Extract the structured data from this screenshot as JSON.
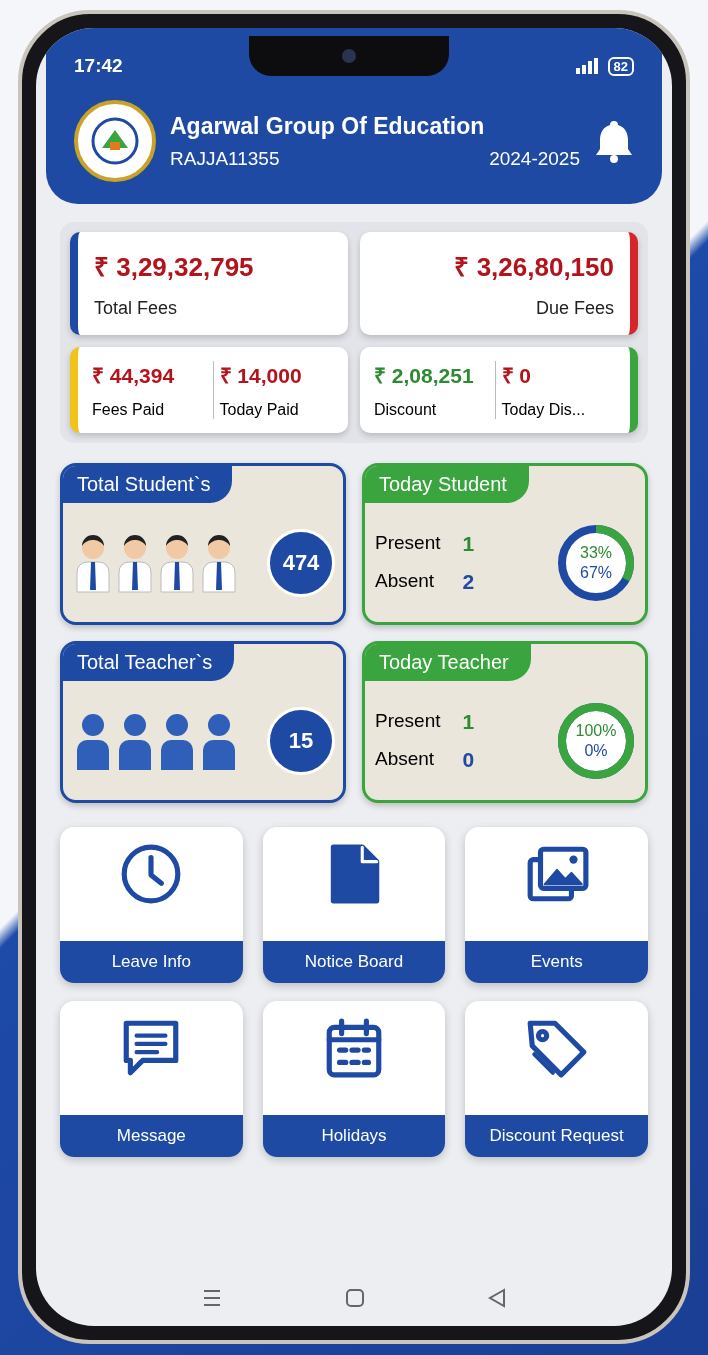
{
  "status_bar": {
    "time": "17:42",
    "battery": "82"
  },
  "header": {
    "school": "Agarwal Group Of Education",
    "code": "RAJJA11355",
    "session": "2024-2025"
  },
  "fee_cards": [
    {
      "amount": "₹ 3,29,32,795",
      "label": "Total Fees",
      "color": "#1f4aa3"
    },
    {
      "amount": "₹ 3,26,80,150",
      "label": "Due Fees",
      "color": "#d7262b"
    }
  ],
  "fee_pairs": [
    {
      "color": "#f0c419",
      "items": [
        {
          "amount": "₹ 44,394",
          "label": "Fees Paid",
          "color": "#b3141c"
        },
        {
          "amount": "₹ 14,000",
          "label": "Today Paid",
          "color": "#b3141c"
        }
      ]
    },
    {
      "color": "#3aa53f",
      "items": [
        {
          "amount": "₹ 2,08,251",
          "label": "Discount",
          "color": "#2e8b34"
        },
        {
          "amount": "₹ 0",
          "label": "Today Dis...",
          "color": "#b3141c"
        }
      ]
    }
  ],
  "summary_cards": [
    {
      "kind": "students",
      "title": "Total Student`s",
      "count": "474",
      "color": "#1f4aa3"
    },
    {
      "kind": "attendance",
      "title": "Today Student",
      "color": "#3aa53f",
      "present_label": "Present",
      "present": "1",
      "absent_label": "Absent",
      "absent": "2",
      "present_pct": "33%",
      "absent_pct": "67%"
    },
    {
      "kind": "teachers",
      "title": "Total Teacher`s",
      "count": "15",
      "color": "#1f4aa3"
    },
    {
      "kind": "attendance",
      "title": "Today Teacher",
      "color": "#3aa53f",
      "present_label": "Present",
      "present": "1",
      "absent_label": "Absent",
      "absent": "0",
      "present_pct": "100%",
      "absent_pct": "0%"
    }
  ],
  "menu": [
    {
      "label": "Leave Info"
    },
    {
      "label": "Notice Board"
    },
    {
      "label": "Events"
    },
    {
      "label": "Message"
    },
    {
      "label": "Holidays"
    },
    {
      "label": "Discount Request"
    }
  ]
}
